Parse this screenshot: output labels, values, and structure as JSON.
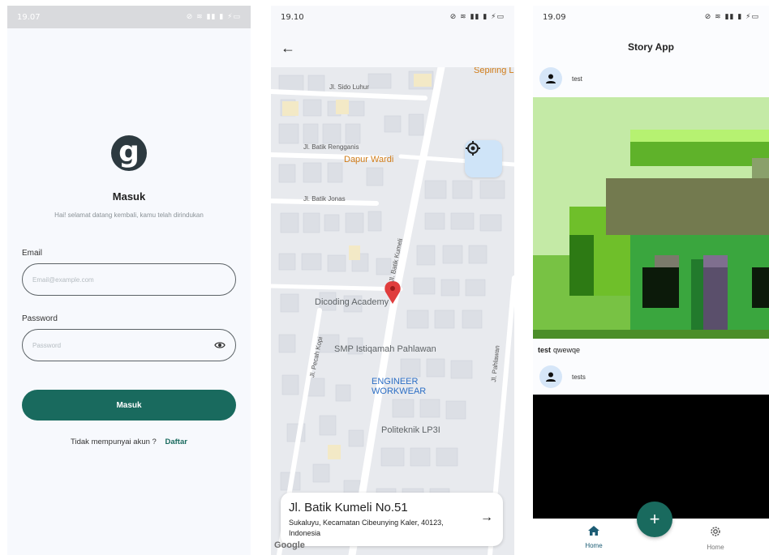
{
  "login": {
    "status_time": "19.07",
    "status_icons": "⊘ ≋ ▮▮ ▮ ⚡▭",
    "title": "Masuk",
    "subtitle": "Hai! selamat datang kembali, kamu telah dirindukan",
    "email_label": "Email",
    "email_placeholder": "Email@example.com",
    "password_label": "Password",
    "password_placeholder": "Password",
    "login_button": "Masuk",
    "no_account_text": "Tidak mempunyai akun ?",
    "register_link": "Daftar",
    "logo_glyph": "g",
    "accent_color": "#196a5e"
  },
  "map": {
    "status_time": "19.10",
    "status_icons": "⊘ ≋ ▮▮ ▮ ⚡▭",
    "streets": {
      "sido_luhur": "Jl. Sido Luhur",
      "batik_rengganis": "Jl. Batik Rengganis",
      "batik_jonas": "Jl. Batik Jonas",
      "batik_kumeli": "Jl. Batik Kumeli",
      "pecah_kopi": "Jl. Pecah Kopi",
      "pahlawan": "Jl. Pahlawan"
    },
    "pois": {
      "sepiring": "Sepiring L",
      "dapur_wardi": "Dapur Wardi",
      "dicoding": "Dicoding Academy",
      "smp": "SMP Istiqamah Pahlawan",
      "engineer_line1": "ENGINEER",
      "engineer_line2": "WORKWEAR",
      "politeknik": "Politeknik LP3I"
    },
    "address_title": "Jl. Batik Kumeli No.51",
    "address_detail": "Sukaluyu, Kecamatan Cibeunying Kaler, 40123, Indonesia",
    "google_logo": "Google"
  },
  "story": {
    "status_time": "19.09",
    "status_icons": "⊘ ≋ ▮▮ ▮ ⚡▭",
    "app_title": "Story App",
    "stories": [
      {
        "username": "test",
        "caption_user": "test",
        "caption": "qwewqe"
      },
      {
        "username": "tests"
      }
    ],
    "nav": {
      "home_label": "Home",
      "settings_label": "Home"
    },
    "fab_label": "+"
  }
}
